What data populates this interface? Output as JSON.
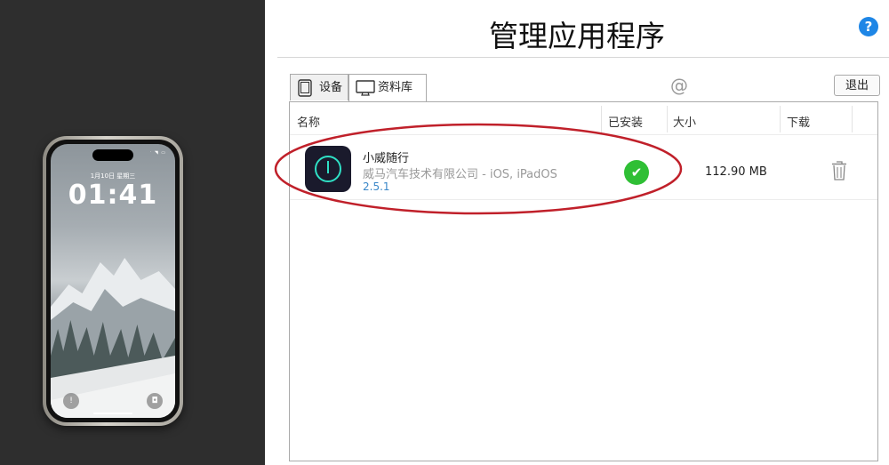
{
  "window": {
    "title": "管理应用程序"
  },
  "phone": {
    "status_icons": "ᐧ ◥ ▭",
    "lock_date": "1月10日 星期三",
    "lock_time": "01:41",
    "left_button": "!",
    "right_button": "◘"
  },
  "toolbar": {
    "help_label": "?",
    "at_symbol": "@",
    "logout_label": "退出"
  },
  "tabs": [
    {
      "label": "设备",
      "icon": "tablet-icon",
      "selected": false
    },
    {
      "label": "资料库",
      "icon": "monitor-icon",
      "selected": true
    }
  ],
  "table": {
    "columns": [
      "名称",
      "已安装",
      "大小",
      "下载"
    ],
    "rows": [
      {
        "name": "小威随行",
        "publisher": "威马汽车技术有限公司 - iOS, iPadOS",
        "version": "2.5.1",
        "installed_mark": "✔",
        "size": "112.90 MB",
        "action_icon": "trash-icon"
      }
    ]
  },
  "colors": {
    "accent": "#1e86e6",
    "installed": "#2fbf35",
    "version_link": "#3a87c8",
    "highlight": "#c0202a",
    "left_panel": "#2e2e2e"
  }
}
